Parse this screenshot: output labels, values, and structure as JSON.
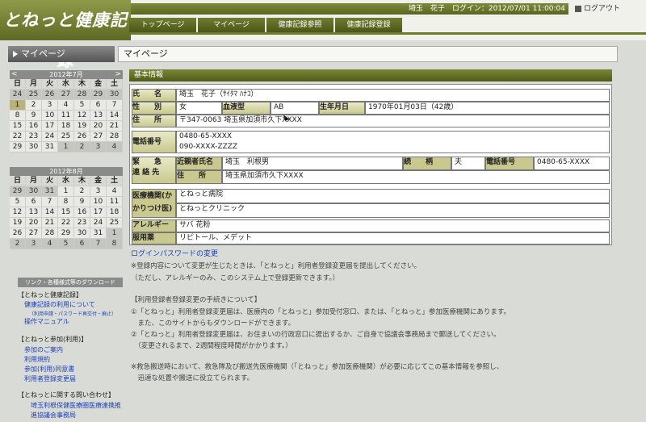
{
  "app": {
    "title": "とねっと健康記録"
  },
  "header": {
    "user_info": "埼玉　花子　ログイン：2012/07/01 11:00:04",
    "logout_label": "ログアウト",
    "nav": [
      "トップページ",
      "マイページ",
      "健康記録参照",
      "健康記録登録"
    ]
  },
  "breadcrumb": {
    "section": "マイページ",
    "page": "マイページ"
  },
  "calendars": [
    {
      "title": "2012年7月",
      "prev": "<",
      "next": ">",
      "weekdays": [
        "日",
        "月",
        "火",
        "水",
        "木",
        "金",
        "土"
      ],
      "weeks": [
        [
          "24",
          "25",
          "26",
          "27",
          "28",
          "29",
          "30"
        ],
        [
          "1",
          "2",
          "3",
          "4",
          "5",
          "6",
          "7"
        ],
        [
          "8",
          "9",
          "10",
          "11",
          "12",
          "13",
          "14"
        ],
        [
          "15",
          "16",
          "17",
          "18",
          "19",
          "20",
          "21"
        ],
        [
          "22",
          "23",
          "24",
          "25",
          "26",
          "27",
          "28"
        ],
        [
          "29",
          "30",
          "31",
          "1",
          "2",
          "3",
          "4"
        ]
      ]
    },
    {
      "title": "2012年8月",
      "weekdays": [
        "日",
        "月",
        "火",
        "水",
        "木",
        "金",
        "土"
      ],
      "weeks": [
        [
          "29",
          "30",
          "31",
          "1",
          "2",
          "3",
          "4"
        ],
        [
          "5",
          "6",
          "7",
          "8",
          "9",
          "10",
          "11"
        ],
        [
          "12",
          "13",
          "14",
          "15",
          "16",
          "17",
          "18"
        ],
        [
          "19",
          "20",
          "21",
          "22",
          "23",
          "24",
          "25"
        ],
        [
          "26",
          "27",
          "28",
          "29",
          "30",
          "31",
          "1"
        ],
        [
          "2",
          "3",
          "4",
          "5",
          "6",
          "7",
          "8"
        ]
      ]
    }
  ],
  "sidebar": {
    "links_header": "リンク・各種様式等のダウンロード",
    "groups": [
      {
        "title": "【とねっと健康記録】",
        "items": [
          "健康記録の利用について",
          "（利用申請・パスワード再交付・廃止）",
          "操作マニュアル"
        ]
      },
      {
        "title": "【とねっと参加(利用)】",
        "items": [
          "参加のご案内",
          "利用規約",
          "参加(利用)同意書",
          "利用者登録変更届"
        ]
      },
      {
        "title": "【とねっとに関する問い合わせ】",
        "items": [
          "埼玉利根保健医療圏医療連携推",
          "進協議会事務局"
        ]
      }
    ]
  },
  "basic_info": {
    "section_title": "基本情報",
    "labels": {
      "name": "氏　　名",
      "gender": "性　　別",
      "blood": "血液型",
      "dob": "生年月日",
      "address": "住　　所",
      "phone": "電話番号",
      "emergency_1": "緊　　急",
      "emergency_2": "連 絡 先",
      "relative_name": "近親者氏名",
      "relationship": "続　　柄",
      "rel_phone": "電話番号",
      "rel_address": "住　　所",
      "medical": "医療機関(かかりつけ医)",
      "allergy": "アレルギー",
      "medication": "服用薬"
    },
    "values": {
      "name": "埼玉　花子（ｻｲﾀﾏ ﾊﾅｺ）",
      "gender": "女",
      "blood": "AB",
      "dob": "1970年01月03日（42歳）",
      "postal": "〒347-0063",
      "address": "埼玉県加須市久下XXXX",
      "phone_1": "0480-65-XXXX",
      "phone_2": "090-XXXX-ZZZZ",
      "relative_name": "埼玉　利根男",
      "relationship": "夫",
      "rel_phone": "0480-65-XXXX",
      "rel_address": "埼玉県加須市久下XXXX",
      "medical_1": "とねっと病院",
      "medical_2": "とねっとクリニック",
      "allergy": "サバ 花粉",
      "medication": "リピトール、メデット"
    }
  },
  "password_link": "ログインパスワードの変更",
  "notes": [
    "※登録内容について変更が生じたときは、「とねっと」利用者登録変更届を提出してください。",
    "（ただし、アレルギーのみ、このシステム上で登録更新できます。）",
    "【利用登録者登録変更の手続きについて】",
    "①「とねっと」利用者登録変更届は、医療内の「とねっと」参加受付窓口、または、「とねっと」参加医療機関にあります。",
    "　また、このサイトからもダウンロードができます。",
    "②「とねっと」利用者登録変更届は、お住まいの行政窓口に提出するか、ご自身で協議会事務局まで郵送してください。",
    "　（変更されるまで、2週間程度時間がかかります。）",
    "※救急搬送時において、救急隊及び搬送先医療機関（「とねっと」参加医療機関）が必要に応じてこの基本情報を参照し、",
    "　迅速な処置や搬送に役立てられます。"
  ]
}
